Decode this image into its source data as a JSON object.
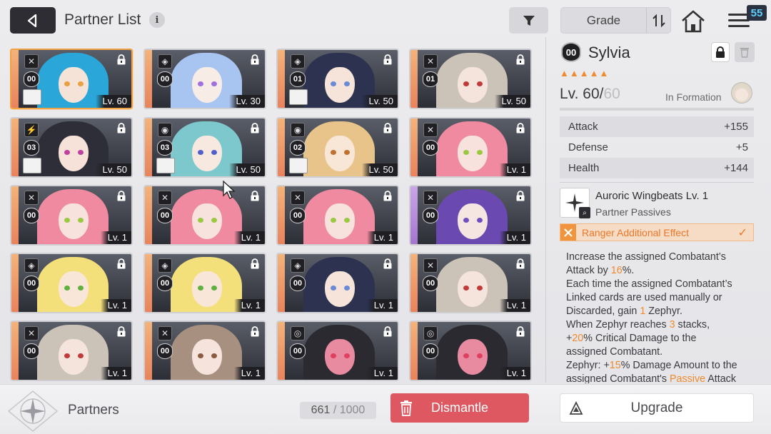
{
  "header": {
    "title": "Partner List",
    "info_icon": "i",
    "sort_label": "Grade",
    "menu_badge": "55"
  },
  "cards": [
    {
      "badge": "00",
      "level": "Lv. 60",
      "role": "✕",
      "selected": true,
      "hair": "#2aa7d8",
      "eye": "#e8a040",
      "skin": "#f6e3d8",
      "mini": true
    },
    {
      "badge": "00",
      "level": "Lv. 30",
      "role": "◈",
      "selected": false,
      "hair": "#a8c4f0",
      "eye": "#a070e0",
      "skin": "#f8ece6",
      "mini": false
    },
    {
      "badge": "01",
      "level": "Lv. 50",
      "role": "◈",
      "selected": false,
      "hair": "#2c3250",
      "eye": "#6a8ad8",
      "skin": "#f6e4da",
      "mini": true
    },
    {
      "badge": "01",
      "level": "Lv. 50",
      "role": "✕",
      "selected": false,
      "hair": "#cbc2b8",
      "eye": "#c03a3a",
      "skin": "#f5e4dc",
      "mini": false
    },
    {
      "badge": "03",
      "level": "Lv. 50",
      "role": "⚡",
      "selected": false,
      "hair": "#2e2e38",
      "eye": "#c040a0",
      "skin": "#f6e2d8",
      "mini": true
    },
    {
      "badge": "03",
      "level": "Lv. 50",
      "role": "◉",
      "selected": false,
      "hair": "#7cc8cc",
      "eye": "#5060c8",
      "skin": "#f7e8e0",
      "mini": true
    },
    {
      "badge": "02",
      "level": "Lv. 50",
      "role": "◉",
      "selected": false,
      "hair": "#e8c48a",
      "eye": "#c07030",
      "skin": "#f8e6d6",
      "mini": true
    },
    {
      "badge": "00",
      "level": "Lv. 1",
      "role": "✕",
      "selected": false,
      "hair": "#f08aa0",
      "eye": "#9ac840",
      "skin": "#f8e2de",
      "mini": false
    },
    {
      "badge": "00",
      "level": "Lv. 1",
      "role": "✕",
      "selected": false,
      "hair": "#f08aa0",
      "eye": "#9ac840",
      "skin": "#f8e2de",
      "mini": false
    },
    {
      "badge": "00",
      "level": "Lv. 1",
      "role": "✕",
      "selected": false,
      "hair": "#f08aa0",
      "eye": "#9ac840",
      "skin": "#f8e2de",
      "mini": false
    },
    {
      "badge": "00",
      "level": "Lv. 1",
      "role": "✕",
      "selected": false,
      "hair": "#f08aa0",
      "eye": "#9ac840",
      "skin": "#f8e2de",
      "mini": false
    },
    {
      "badge": "00",
      "level": "Lv. 1",
      "role": "✕",
      "selected": false,
      "hair": "#6a4ab0",
      "eye": "#7050c0",
      "skin": "#f6e6e2",
      "mini": false,
      "purple": true
    },
    {
      "badge": "00",
      "level": "Lv. 1",
      "role": "◈",
      "selected": false,
      "hair": "#f4e07a",
      "eye": "#60b040",
      "skin": "#f8e6d8",
      "mini": false
    },
    {
      "badge": "00",
      "level": "Lv. 1",
      "role": "◈",
      "selected": false,
      "hair": "#f4e07a",
      "eye": "#60b040",
      "skin": "#f8e6d8",
      "mini": false
    },
    {
      "badge": "00",
      "level": "Lv. 1",
      "role": "◈",
      "selected": false,
      "hair": "#2c3250",
      "eye": "#6a8ad8",
      "skin": "#f6e4da",
      "mini": false
    },
    {
      "badge": "00",
      "level": "Lv. 1",
      "role": "✕",
      "selected": false,
      "hair": "#cbc2b8",
      "eye": "#c03a3a",
      "skin": "#f5e4dc",
      "mini": false
    },
    {
      "badge": "00",
      "level": "Lv. 1",
      "role": "✕",
      "selected": false,
      "hair": "#cbc2b8",
      "eye": "#c03a3a",
      "skin": "#f5e4dc",
      "mini": false
    },
    {
      "badge": "00",
      "level": "Lv. 1",
      "role": "✕",
      "selected": false,
      "hair": "#a89080",
      "eye": "#8a5a40",
      "skin": "#f6e4dc",
      "mini": false
    },
    {
      "badge": "00",
      "level": "Lv. 1",
      "role": "◎",
      "selected": false,
      "hair": "#2a2a30",
      "eye": "#e04060",
      "skin": "#e88aa0",
      "mini": false
    },
    {
      "badge": "00",
      "level": "Lv. 1",
      "role": "◎",
      "selected": false,
      "hair": "#2a2a30",
      "eye": "#e04060",
      "skin": "#e88aa0",
      "mini": false
    }
  ],
  "detail": {
    "badge": "00",
    "name": "Sylvia",
    "stars": 5,
    "level_current": "Lv. 60/",
    "level_max": "60",
    "formation": "In Formation",
    "stats": [
      {
        "label": "Attack",
        "value": "+155"
      },
      {
        "label": "Defense",
        "value": "+5"
      },
      {
        "label": "Health",
        "value": "+144"
      }
    ],
    "skill_name": "Auroric Wingbeats Lv. 1",
    "skill_sub": "Partner Passives",
    "effect_label": "Ranger Additional Effect",
    "desc": {
      "l1a": "Increase the assigned Combatant’s",
      "l2a": "Attack by ",
      "l2b": "16",
      "l2c": "%.",
      "l3a": "Each time the assigned Combatant’s",
      "l4a": "Linked cards are used manually or",
      "l5a": "Discarded, gain ",
      "l5b": "1",
      "l5c": " Zephyr.",
      "l6a": "When Zephyr reaches ",
      "l6b": "3",
      "l6c": " stacks,",
      "l7a": "+",
      "l7b": "20",
      "l7c": "% Critical Damage to the",
      "l8a": "assigned Combatant.",
      "l9a": "Zephyr: +",
      "l9b": "15",
      "l9c": "% Damage Amount to the",
      "l10a": "assigned Combatant's ",
      "l10b": "Passive",
      "l10c": " Attack"
    }
  },
  "footer": {
    "partners_label": "Partners",
    "count": "661",
    "count_max": " / 1000",
    "dismantle_label": "Dismantle",
    "upgrade_label": "Upgrade"
  },
  "colors": {
    "accent": "#f08a2c",
    "dismantle": "#dd5860",
    "selected_border": "#f0a246"
  }
}
